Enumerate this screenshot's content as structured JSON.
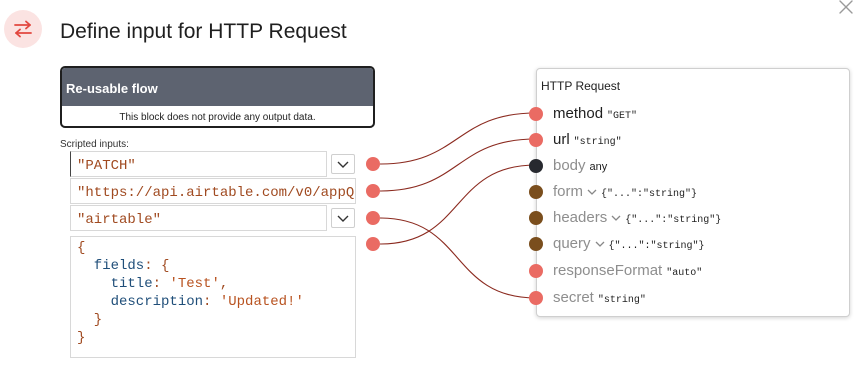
{
  "dialog": {
    "title": "Define input for HTTP Request",
    "icon": "swap-arrows-icon",
    "close_icon": "close-icon"
  },
  "reusable_flow": {
    "title": "Re-usable flow",
    "message": "This block does not provide any output data."
  },
  "scripted_inputs": {
    "label": "Scripted inputs:",
    "values": [
      "\"PATCH\"",
      "\"https://api.airtable.com/v0/appQ",
      "\"airtable\""
    ],
    "code_lines": [
      [
        {
          "t": "punct",
          "v": "{"
        }
      ],
      [
        {
          "t": "key",
          "v": "  fields"
        },
        {
          "t": "punct",
          "v": ": {"
        }
      ],
      [
        {
          "t": "key",
          "v": "    title"
        },
        {
          "t": "punct",
          "v": ": "
        },
        {
          "t": "str",
          "v": "'Test'"
        },
        {
          "t": "punct",
          "v": ","
        }
      ],
      [
        {
          "t": "key",
          "v": "    description"
        },
        {
          "t": "punct",
          "v": ": "
        },
        {
          "t": "str",
          "v": "'Updated!'"
        }
      ],
      [
        {
          "t": "punct",
          "v": "  }"
        }
      ],
      [
        {
          "t": "punct",
          "v": "}"
        }
      ]
    ]
  },
  "http_request": {
    "title": "HTTP Request",
    "params": [
      {
        "name": "method",
        "type": "\"GET\"",
        "active": true,
        "port": "coral",
        "chevron": false,
        "mono": true
      },
      {
        "name": "url",
        "type": "\"string\"",
        "active": true,
        "port": "coral",
        "chevron": false,
        "mono": true
      },
      {
        "name": "body",
        "type": "any",
        "active": false,
        "port": "dark",
        "chevron": false,
        "mono": false
      },
      {
        "name": "form",
        "type": "{\"...\":\"string\"}",
        "active": false,
        "port": "brown",
        "chevron": true,
        "mono": true
      },
      {
        "name": "headers",
        "type": "{\"...\":\"string\"}",
        "active": false,
        "port": "brown",
        "chevron": true,
        "mono": true
      },
      {
        "name": "query",
        "type": "{\"...\":\"string\"}",
        "active": false,
        "port": "brown",
        "chevron": true,
        "mono": true
      },
      {
        "name": "responseFormat",
        "type": "\"auto\"",
        "active": false,
        "port": "coral",
        "chevron": false,
        "mono": true
      },
      {
        "name": "secret",
        "type": "\"string\"",
        "active": false,
        "port": "coral",
        "chevron": false,
        "mono": true
      }
    ]
  },
  "colors": {
    "port_coral": "#ea6b63",
    "port_dark": "#27292f",
    "port_brown": "#7a4e1d",
    "wire": "#8b2a1f",
    "flow_header": "#5d6370"
  }
}
